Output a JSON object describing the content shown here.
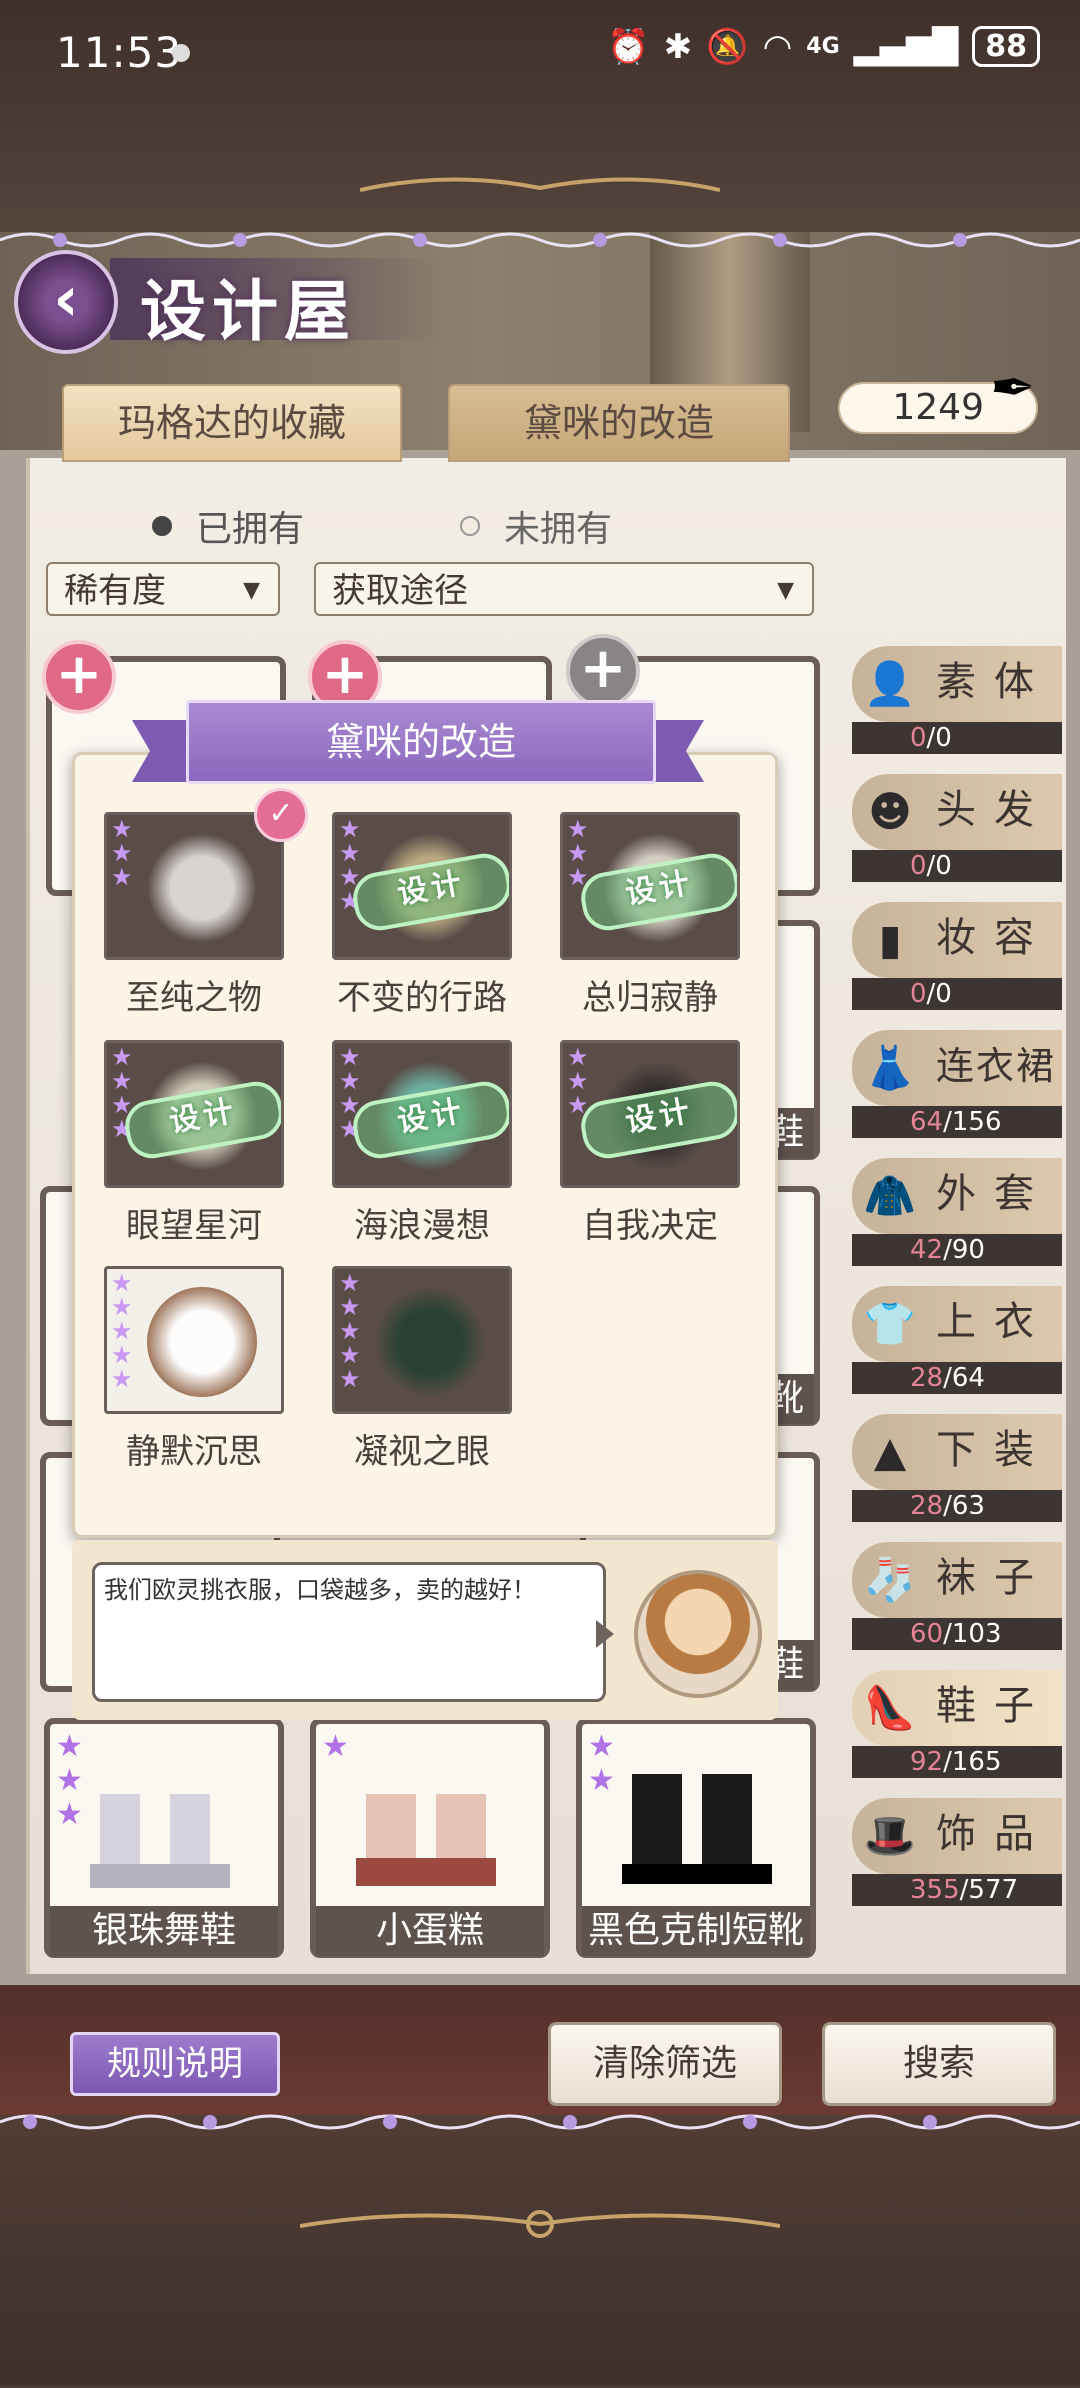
{
  "status": {
    "time": "11:53",
    "battery": "88",
    "network": "4G"
  },
  "header": {
    "title": "设计屋",
    "back_icon": "chevron-left-icon"
  },
  "tabs": [
    {
      "label": "玛格达的收藏"
    },
    {
      "label": "黛咪的改造"
    }
  ],
  "currency": {
    "value": "1249"
  },
  "filters": {
    "ownership": [
      {
        "label": "已拥有",
        "selected": true
      },
      {
        "label": "未拥有",
        "selected": false
      }
    ],
    "rarity": {
      "label": "稀有度"
    },
    "source": {
      "label": "获取途径"
    }
  },
  "categories": [
    {
      "name": "素体",
      "owned": "0",
      "total": "/0",
      "icon": "body-icon"
    },
    {
      "name": "头发",
      "owned": "0",
      "total": "/0",
      "icon": "hair-icon"
    },
    {
      "name": "妆容",
      "owned": "0",
      "total": "/0",
      "icon": "lipstick-icon"
    },
    {
      "name": "连衣裙",
      "owned": "64",
      "total": "/156",
      "icon": "dress-icon"
    },
    {
      "name": "外套",
      "owned": "42",
      "total": "/90",
      "icon": "coat-icon"
    },
    {
      "name": "上衣",
      "owned": "28",
      "total": "/64",
      "icon": "shirt-icon"
    },
    {
      "name": "下装",
      "owned": "28",
      "total": "/63",
      "icon": "skirt-icon"
    },
    {
      "name": "袜子",
      "owned": "60",
      "total": "/103",
      "icon": "socks-icon"
    },
    {
      "name": "鞋子",
      "owned": "92",
      "total": "/165",
      "icon": "shoe-icon"
    },
    {
      "name": "饰品",
      "owned": "355",
      "total": "/577",
      "icon": "hat-icon"
    }
  ],
  "popup": {
    "title": "黛咪的改造",
    "stamp_label": "设计",
    "items": [
      {
        "name": "至纯之物",
        "stars": 3,
        "design": false,
        "checked": true
      },
      {
        "name": "不变的行路",
        "stars": 4,
        "design": true
      },
      {
        "name": "总归寂静",
        "stars": 3,
        "design": true
      },
      {
        "name": "眼望星河",
        "stars": 4,
        "design": true
      },
      {
        "name": "海浪漫想",
        "stars": 4,
        "design": true
      },
      {
        "name": "自我决定",
        "stars": 3,
        "design": true
      },
      {
        "name": "静默沉思",
        "stars": 5,
        "design": false
      },
      {
        "name": "凝视之眼",
        "stars": 5,
        "design": false
      }
    ]
  },
  "dialogue": {
    "text": "我们欧灵挑衣服，口袋越多，卖的越好！"
  },
  "grid_bottom": [
    {
      "name": "银珠舞鞋",
      "stars": 3
    },
    {
      "name": "小蛋糕",
      "stars": 1
    },
    {
      "name": "黑色克制短靴",
      "stars": 2
    }
  ],
  "grid_partial_labels": [
    "鞋",
    "鞋",
    "靴"
  ],
  "buttons": {
    "rules": "规则说明",
    "clear": "清除筛选",
    "search": "搜索"
  }
}
